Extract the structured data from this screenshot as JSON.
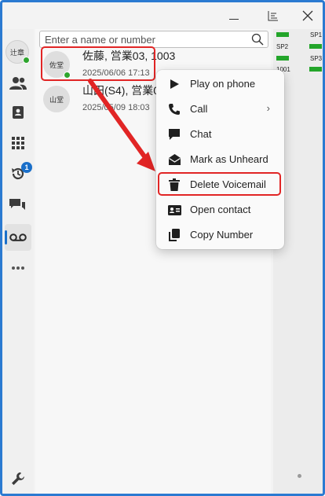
{
  "my_avatar": {
    "initials": "辻章"
  },
  "rail": {
    "history_badge": "1"
  },
  "search": {
    "placeholder": "Enter a name or number"
  },
  "voicemails": [
    {
      "initials": "佐堂",
      "name": "佐藤, 営業03, 1003",
      "date": "2025/06/06 17:13"
    },
    {
      "initials": "山堂",
      "name": "山田(S4), 営業04, 1004",
      "date": "2025/05/09 18:03"
    }
  ],
  "context_menu": [
    {
      "label": "Play on phone",
      "icon": "play-icon"
    },
    {
      "label": "Call",
      "icon": "phone-icon",
      "submenu_arrow": "›"
    },
    {
      "label": "Chat",
      "icon": "chat-icon"
    },
    {
      "label": "Mark as Unheard",
      "icon": "envelope-open-icon"
    },
    {
      "label": "Delete Voicemail",
      "icon": "trash-icon"
    },
    {
      "label": "Open contact",
      "icon": "contact-card-icon"
    },
    {
      "label": "Copy Number",
      "icon": "copy-icon"
    }
  ],
  "speed_panel": {
    "labels": [
      "SP1",
      "SP2",
      "SP3"
    ],
    "partial_number": "1001"
  },
  "colors": {
    "accent": "#1a6fc9",
    "presence": "#2ea52e",
    "highlight": "#e12525",
    "sp_bar": "#23a52a"
  }
}
